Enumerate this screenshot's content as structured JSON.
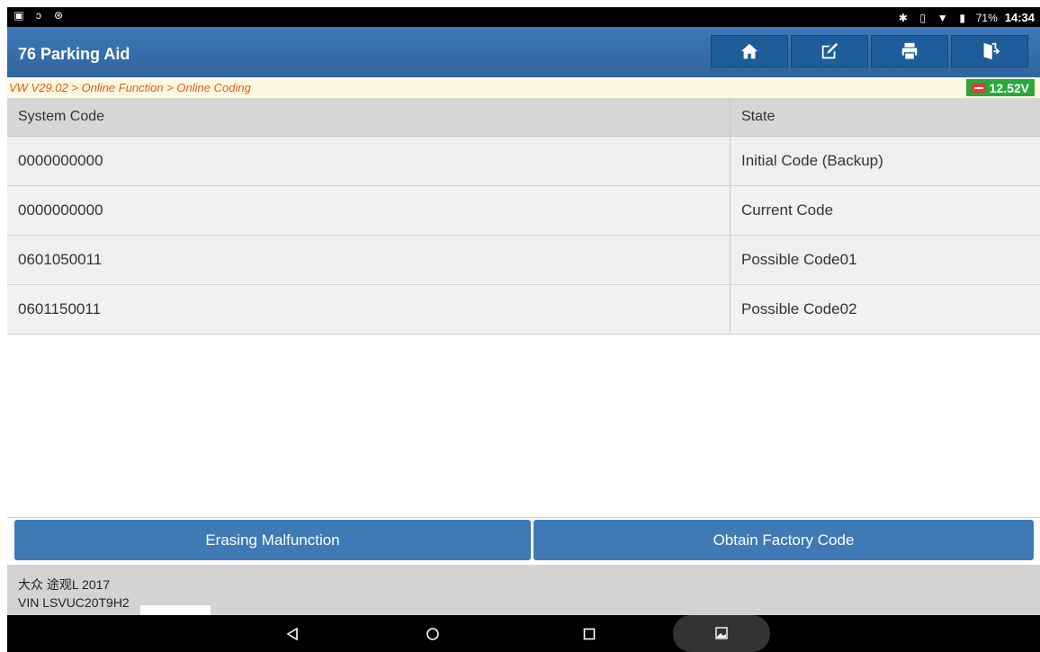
{
  "status": {
    "battery": "71%",
    "time": "14:34"
  },
  "header": {
    "title": "76 Parking Aid",
    "buttons": [
      "home-icon",
      "edit-icon",
      "print-icon",
      "exit-icon"
    ]
  },
  "breadcrumb": "VW V29.02 > Online Function > Online Coding",
  "voltage": "12.52V",
  "table": {
    "columns": [
      "System Code",
      "State"
    ],
    "rows": [
      [
        "0000000000",
        "Initial Code (Backup)"
      ],
      [
        "0000000000",
        "Current Code"
      ],
      [
        "0601050011",
        "Possible Code01"
      ],
      [
        "0601150011",
        "Possible Code02"
      ]
    ]
  },
  "actions": {
    "erase": "Erasing Malfunction",
    "factory": "Obtain Factory Code"
  },
  "vehicle": {
    "model": "大众 途观L 2017",
    "vin": "VIN LSVUC20T9H2"
  },
  "colors": {
    "header": "#2e629c",
    "button": "#3f7ab6",
    "voltage": "#2aa83c",
    "crumb": "#e05a1a"
  }
}
